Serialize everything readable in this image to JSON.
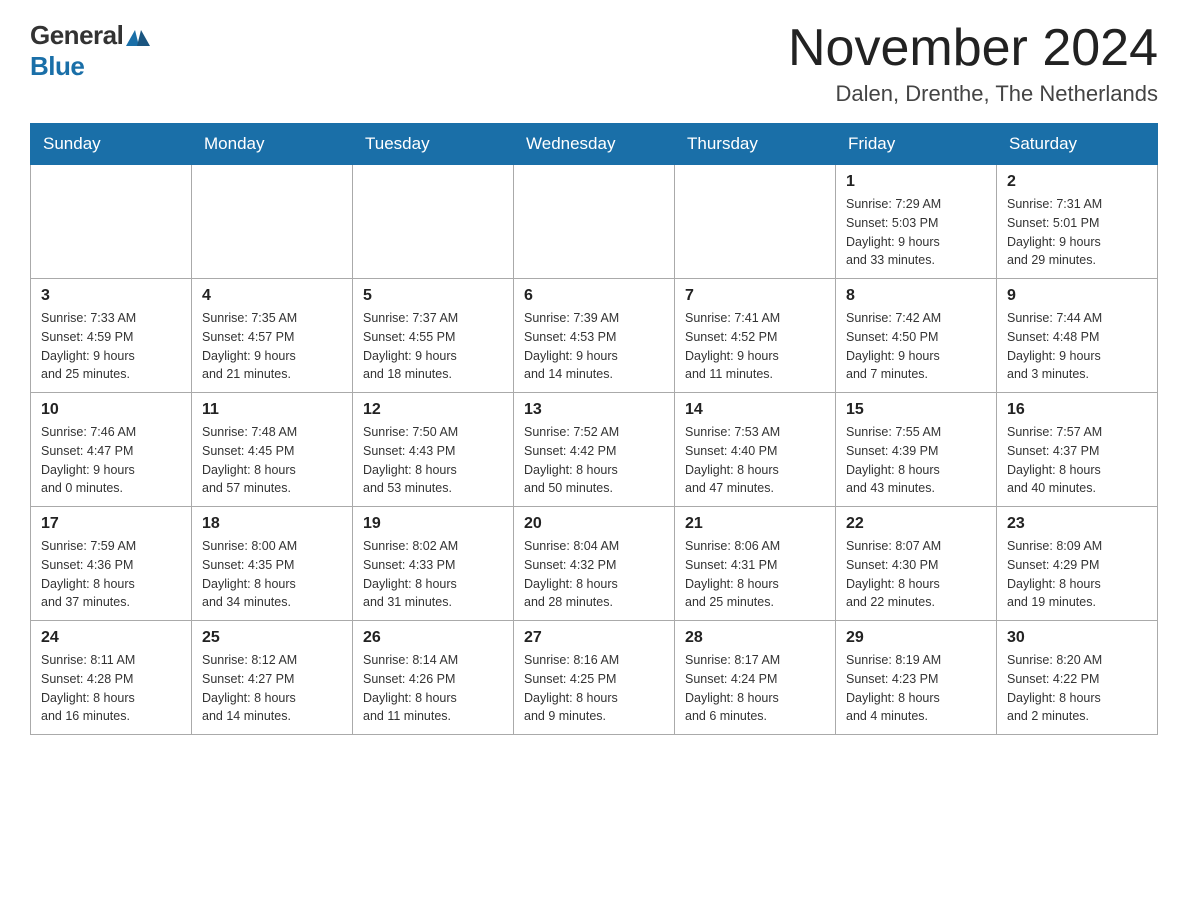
{
  "header": {
    "logo_general": "General",
    "logo_blue": "Blue",
    "month_title": "November 2024",
    "location": "Dalen, Drenthe, The Netherlands"
  },
  "days_of_week": [
    "Sunday",
    "Monday",
    "Tuesday",
    "Wednesday",
    "Thursday",
    "Friday",
    "Saturday"
  ],
  "weeks": [
    {
      "days": [
        {
          "number": "",
          "info": ""
        },
        {
          "number": "",
          "info": ""
        },
        {
          "number": "",
          "info": ""
        },
        {
          "number": "",
          "info": ""
        },
        {
          "number": "",
          "info": ""
        },
        {
          "number": "1",
          "info": "Sunrise: 7:29 AM\nSunset: 5:03 PM\nDaylight: 9 hours\nand 33 minutes."
        },
        {
          "number": "2",
          "info": "Sunrise: 7:31 AM\nSunset: 5:01 PM\nDaylight: 9 hours\nand 29 minutes."
        }
      ]
    },
    {
      "days": [
        {
          "number": "3",
          "info": "Sunrise: 7:33 AM\nSunset: 4:59 PM\nDaylight: 9 hours\nand 25 minutes."
        },
        {
          "number": "4",
          "info": "Sunrise: 7:35 AM\nSunset: 4:57 PM\nDaylight: 9 hours\nand 21 minutes."
        },
        {
          "number": "5",
          "info": "Sunrise: 7:37 AM\nSunset: 4:55 PM\nDaylight: 9 hours\nand 18 minutes."
        },
        {
          "number": "6",
          "info": "Sunrise: 7:39 AM\nSunset: 4:53 PM\nDaylight: 9 hours\nand 14 minutes."
        },
        {
          "number": "7",
          "info": "Sunrise: 7:41 AM\nSunset: 4:52 PM\nDaylight: 9 hours\nand 11 minutes."
        },
        {
          "number": "8",
          "info": "Sunrise: 7:42 AM\nSunset: 4:50 PM\nDaylight: 9 hours\nand 7 minutes."
        },
        {
          "number": "9",
          "info": "Sunrise: 7:44 AM\nSunset: 4:48 PM\nDaylight: 9 hours\nand 3 minutes."
        }
      ]
    },
    {
      "days": [
        {
          "number": "10",
          "info": "Sunrise: 7:46 AM\nSunset: 4:47 PM\nDaylight: 9 hours\nand 0 minutes."
        },
        {
          "number": "11",
          "info": "Sunrise: 7:48 AM\nSunset: 4:45 PM\nDaylight: 8 hours\nand 57 minutes."
        },
        {
          "number": "12",
          "info": "Sunrise: 7:50 AM\nSunset: 4:43 PM\nDaylight: 8 hours\nand 53 minutes."
        },
        {
          "number": "13",
          "info": "Sunrise: 7:52 AM\nSunset: 4:42 PM\nDaylight: 8 hours\nand 50 minutes."
        },
        {
          "number": "14",
          "info": "Sunrise: 7:53 AM\nSunset: 4:40 PM\nDaylight: 8 hours\nand 47 minutes."
        },
        {
          "number": "15",
          "info": "Sunrise: 7:55 AM\nSunset: 4:39 PM\nDaylight: 8 hours\nand 43 minutes."
        },
        {
          "number": "16",
          "info": "Sunrise: 7:57 AM\nSunset: 4:37 PM\nDaylight: 8 hours\nand 40 minutes."
        }
      ]
    },
    {
      "days": [
        {
          "number": "17",
          "info": "Sunrise: 7:59 AM\nSunset: 4:36 PM\nDaylight: 8 hours\nand 37 minutes."
        },
        {
          "number": "18",
          "info": "Sunrise: 8:00 AM\nSunset: 4:35 PM\nDaylight: 8 hours\nand 34 minutes."
        },
        {
          "number": "19",
          "info": "Sunrise: 8:02 AM\nSunset: 4:33 PM\nDaylight: 8 hours\nand 31 minutes."
        },
        {
          "number": "20",
          "info": "Sunrise: 8:04 AM\nSunset: 4:32 PM\nDaylight: 8 hours\nand 28 minutes."
        },
        {
          "number": "21",
          "info": "Sunrise: 8:06 AM\nSunset: 4:31 PM\nDaylight: 8 hours\nand 25 minutes."
        },
        {
          "number": "22",
          "info": "Sunrise: 8:07 AM\nSunset: 4:30 PM\nDaylight: 8 hours\nand 22 minutes."
        },
        {
          "number": "23",
          "info": "Sunrise: 8:09 AM\nSunset: 4:29 PM\nDaylight: 8 hours\nand 19 minutes."
        }
      ]
    },
    {
      "days": [
        {
          "number": "24",
          "info": "Sunrise: 8:11 AM\nSunset: 4:28 PM\nDaylight: 8 hours\nand 16 minutes."
        },
        {
          "number": "25",
          "info": "Sunrise: 8:12 AM\nSunset: 4:27 PM\nDaylight: 8 hours\nand 14 minutes."
        },
        {
          "number": "26",
          "info": "Sunrise: 8:14 AM\nSunset: 4:26 PM\nDaylight: 8 hours\nand 11 minutes."
        },
        {
          "number": "27",
          "info": "Sunrise: 8:16 AM\nSunset: 4:25 PM\nDaylight: 8 hours\nand 9 minutes."
        },
        {
          "number": "28",
          "info": "Sunrise: 8:17 AM\nSunset: 4:24 PM\nDaylight: 8 hours\nand 6 minutes."
        },
        {
          "number": "29",
          "info": "Sunrise: 8:19 AM\nSunset: 4:23 PM\nDaylight: 8 hours\nand 4 minutes."
        },
        {
          "number": "30",
          "info": "Sunrise: 8:20 AM\nSunset: 4:22 PM\nDaylight: 8 hours\nand 2 minutes."
        }
      ]
    }
  ]
}
